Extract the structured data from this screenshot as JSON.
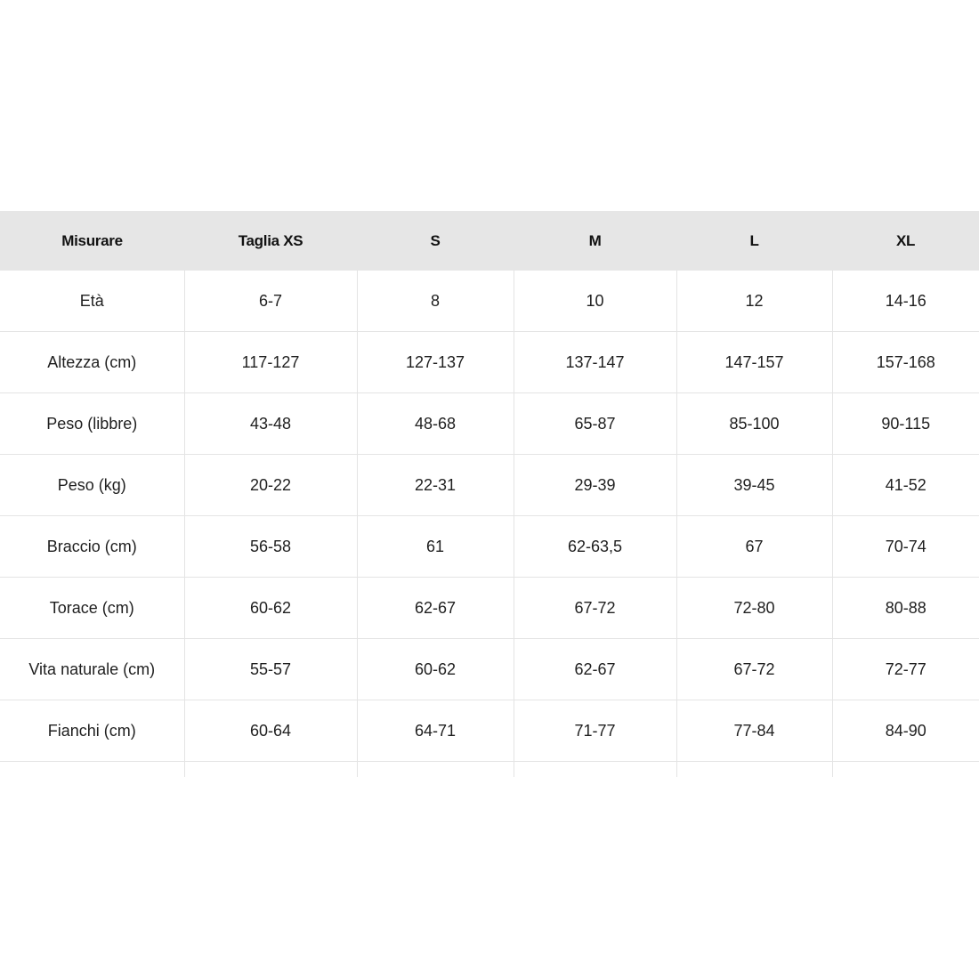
{
  "table": {
    "headers": [
      "Misurare",
      "Taglia XS",
      "S",
      "M",
      "L",
      "XL"
    ],
    "rows": [
      [
        "Età",
        "6-7",
        "8",
        "10",
        "12",
        "14-16"
      ],
      [
        "Altezza (cm)",
        "117-127",
        "127-137",
        "137-147",
        "147-157",
        "157-168"
      ],
      [
        "Peso (libbre)",
        "43-48",
        "48-68",
        "65-87",
        "85-100",
        "90-115"
      ],
      [
        "Peso (kg)",
        "20-22",
        "22-31",
        "29-39",
        "39-45",
        "41-52"
      ],
      [
        "Braccio (cm)",
        "56-58",
        "61",
        "62-63,5",
        "67",
        "70-74"
      ],
      [
        "Torace (cm)",
        "60-62",
        "62-67",
        "67-72",
        "72-80",
        "80-88"
      ],
      [
        "Vita naturale (cm)",
        "55-57",
        "60-62",
        "62-67",
        "67-72",
        "72-77"
      ],
      [
        "Fianchi (cm)",
        "60-64",
        "64-71",
        "71-77",
        "77-84",
        "84-90"
      ]
    ]
  }
}
